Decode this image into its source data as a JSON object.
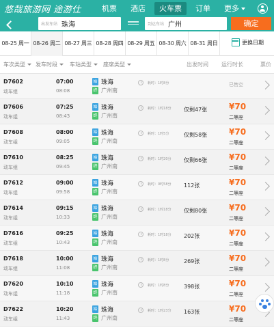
{
  "brand": {
    "logo": "悠哉旅游网 途游仕"
  },
  "nav": {
    "items": [
      "机票",
      "酒店",
      "火车票",
      "订单",
      "更多"
    ]
  },
  "search": {
    "from_label": "出发车站",
    "from_value": "珠海",
    "to_label": "到达车站",
    "to_value": "广州",
    "confirm": "确定"
  },
  "dates": [
    "08-25 周一",
    "08-26 周二",
    "08-27 周三",
    "08-28 周四",
    "08-29 周五",
    "08-30 周六",
    "08-31 周日"
  ],
  "change_date": "更换日期",
  "filters": {
    "type": "车次类型",
    "time": "发车时段",
    "station": "车站类型",
    "seat": "座席类型"
  },
  "headers": {
    "dep": "出发时间",
    "dur": "运行时长",
    "price": "票价"
  },
  "trains": [
    {
      "code": "D7602",
      "type": "动车组",
      "dep": "07:00",
      "arr": "08:08",
      "from": "珠海",
      "to": "广州南",
      "dur": "耗时：1时8分",
      "avail": "",
      "price": "",
      "seat": "",
      "status": "已售空"
    },
    {
      "code": "D7606",
      "type": "动车组",
      "dep": "07:25",
      "arr": "08:43",
      "from": "珠海",
      "to": "广州南",
      "dur": "耗时：1时18分",
      "avail": "仅剩47张",
      "price": "¥70",
      "seat": "二等座",
      "status": ""
    },
    {
      "code": "D7608",
      "type": "动车组",
      "dep": "08:00",
      "arr": "09:05",
      "from": "珠海",
      "to": "广州南",
      "dur": "耗时：1时5分",
      "avail": "仅剩58张",
      "price": "¥70",
      "seat": "二等座",
      "status": ""
    },
    {
      "code": "D7610",
      "type": "动车组",
      "dep": "08:25",
      "arr": "09:45",
      "from": "珠海",
      "to": "广州南",
      "dur": "耗时：1时20分",
      "avail": "仅剩66张",
      "price": "¥70",
      "seat": "二等座",
      "status": ""
    },
    {
      "code": "D7612",
      "type": "动车组",
      "dep": "09:00",
      "arr": "09:58",
      "from": "珠海",
      "to": "广州南",
      "dur": "耗时：0时58分",
      "avail": "112张",
      "price": "¥70",
      "seat": "二等座",
      "status": ""
    },
    {
      "code": "D7614",
      "type": "动车组",
      "dep": "09:15",
      "arr": "10:33",
      "from": "珠海",
      "to": "广州南",
      "dur": "耗时：1时18分",
      "avail": "仅剩80张",
      "price": "¥70",
      "seat": "二等座",
      "status": ""
    },
    {
      "code": "D7616",
      "type": "动车组",
      "dep": "09:25",
      "arr": "10:43",
      "from": "珠海",
      "to": "广州南",
      "dur": "耗时：1时18分",
      "avail": "202张",
      "price": "¥70",
      "seat": "二等座",
      "status": ""
    },
    {
      "code": "D7618",
      "type": "动车组",
      "dep": "10:00",
      "arr": "11:08",
      "from": "珠海",
      "to": "广州南",
      "dur": "耗时：1时8分",
      "avail": "269张",
      "price": "¥70",
      "seat": "二等座",
      "status": ""
    },
    {
      "code": "D7620",
      "type": "动车组",
      "dep": "10:10",
      "arr": "11:18",
      "from": "珠海",
      "to": "广州南",
      "dur": "耗时：1时8分",
      "avail": "398张",
      "price": "¥70",
      "seat": "二等座",
      "status": ""
    },
    {
      "code": "D7622",
      "type": "动车组",
      "dep": "10:20",
      "arr": "11:43",
      "from": "珠海",
      "to": "广州南",
      "dur": "耗时：1时23分",
      "avail": "163张",
      "price": "¥70",
      "seat": "二等座",
      "status": ""
    }
  ],
  "badges": {
    "start": "始",
    "end": "终"
  },
  "colors": {
    "brand": "#2bb1a4",
    "accent": "#f76d1e"
  }
}
